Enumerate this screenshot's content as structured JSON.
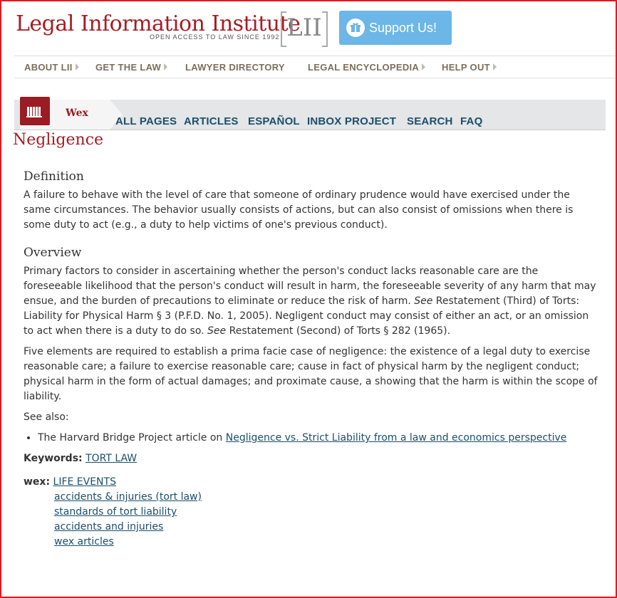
{
  "header": {
    "logo_title": "Legal Information Institute",
    "logo_tagline": "OPEN ACCESS TO LAW SINCE 1992",
    "logo_abbrev": "LII",
    "support_label": "Support Us!",
    "colors": {
      "brand_red": "#a51d24",
      "support_blue": "#6cb6e8",
      "nav_brown": "#7a6f5a"
    }
  },
  "top_nav": {
    "items": [
      {
        "label": "ABOUT LII"
      },
      {
        "label": "GET THE LAW"
      },
      {
        "label": "LAWYER DIRECTORY"
      },
      {
        "label": "LEGAL ENCYCLOPEDIA"
      },
      {
        "label": "HELP OUT"
      }
    ]
  },
  "wex_nav": {
    "tab_label": "Wex",
    "items": [
      {
        "label": "ALL PAGES"
      },
      {
        "label": "ARTICLES"
      },
      {
        "label": "ESPAÑOL"
      },
      {
        "label": "INBOX PROJECT"
      },
      {
        "label": "SEARCH"
      },
      {
        "label": "FAQ"
      }
    ]
  },
  "page": {
    "title": "Negligence",
    "definition": {
      "heading": "Definition",
      "text": "A failure to behave with the level of care that someone of ordinary prudence would have exercised under the same circumstances.  The behavior usually consists of actions, but can also consist of omissions when there is some duty to act (e.g., a duty to help victims of one's previous conduct)."
    },
    "overview": {
      "heading": "Overview",
      "p1_a": "Primary factors to consider in ascertaining whether the person's conduct lacks reasonable care are the foreseeable likelihood that the person's conduct will result in harm, the foreseeable severity of any harm that may ensue, and the burden of precautions to eliminate or reduce the risk of harm. ",
      "see_1": "See",
      "p1_b": " Restatement (Third) of Torts: Liability for Physical Harm § 3 (P.F.D. No. 1, 2005).  Negligent conduct may consist of either an act, or an omission to act when there is a duty to do so.  ",
      "see_2": "See",
      "p1_c": " Restatement (Second) of Torts § 282 (1965).",
      "p2": "Five elements are required to establish a prima facie case of negligence:  the existence of a legal duty to exercise reasonable care; a failure to exercise reasonable care; cause in fact of physical harm by the negligent conduct; physical harm in the form of actual damages; and proximate cause, a showing that the harm is within the scope of liability."
    },
    "see_also": {
      "label": "See also:",
      "item_prefix": "The Harvard Bridge Project article on ",
      "item_link": "Negligence vs. Strict Liability from a law and economics perspective"
    },
    "keywords": {
      "label": "Keywords:",
      "link": "TORT LAW"
    },
    "wex_links": {
      "label": "wex:",
      "items": [
        "LIFE EVENTS",
        "accidents & injuries (tort law)",
        "standards of tort liability",
        "accidents and injuries",
        "wex articles"
      ]
    }
  }
}
